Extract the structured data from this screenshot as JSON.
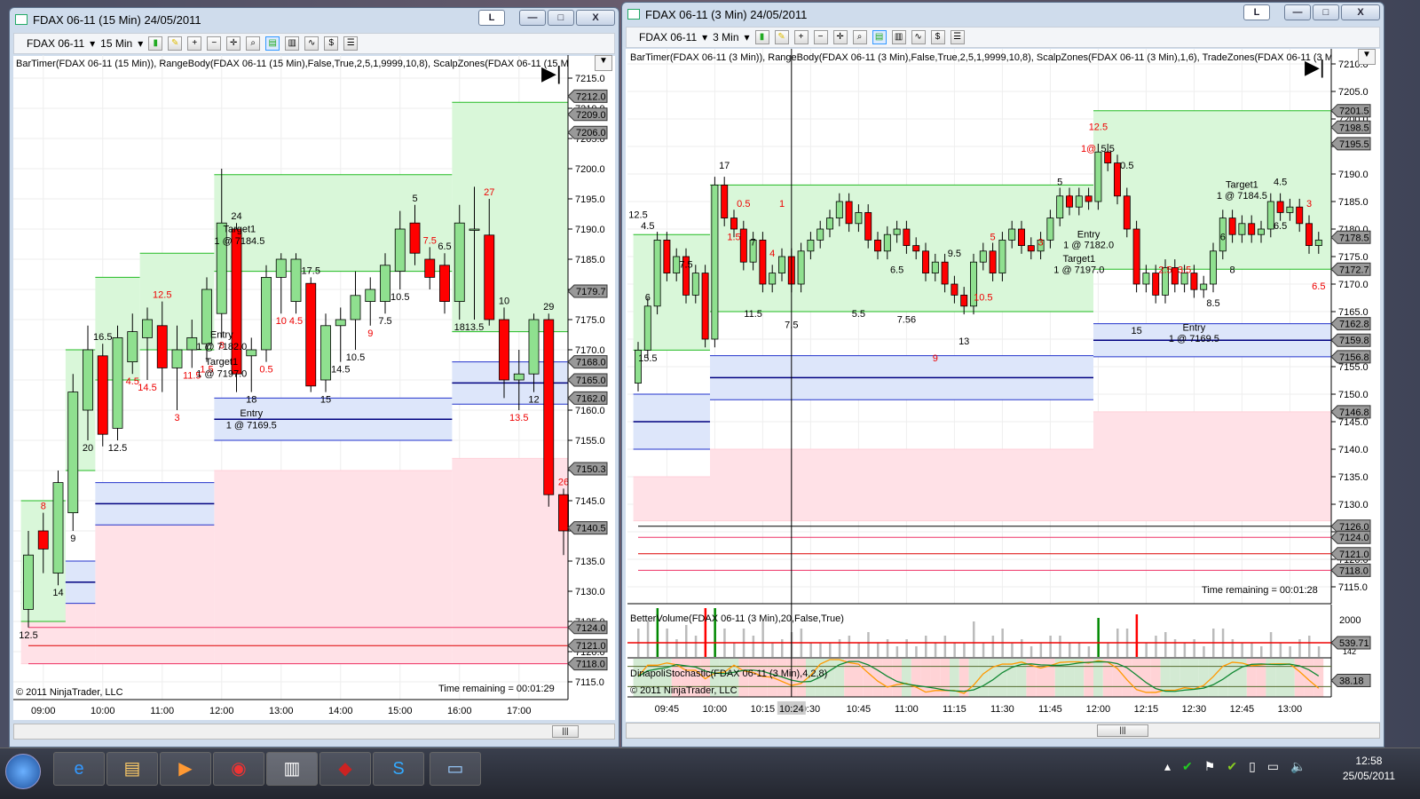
{
  "left": {
    "title": "FDAX 06-11 (15 Min)  24/05/2011",
    "instrument": "FDAX 06-11",
    "interval": "15 Min",
    "L": "L",
    "indicators": "BarTimer(FDAX 06-11 (15 Min)), RangeBody(FDAX 06-11 (15 Min),False,True,2,5,1,9999,10,8), ScalpZones(FDAX 06-11 (15 Min",
    "copyright": "© 2011 NinjaTrader, LLC",
    "time_remaining": "Time remaining = 00:01:29",
    "price_ticks": [
      7215,
      7210,
      7205,
      7200,
      7195,
      7190,
      7185,
      7180,
      7175,
      7170,
      7165,
      7160,
      7155,
      7150,
      7145,
      7140,
      7135,
      7130,
      7125,
      7120,
      7115
    ],
    "price_tags": [
      "7212.0",
      "7209.0",
      "7206.0",
      "7179.7",
      "7168.0",
      "7165.0",
      "7162.0",
      "7150.3",
      "7140.5",
      "7124.0",
      "7121.0",
      "7118.0"
    ],
    "time_labels": [
      [
        "09:00",
        540
      ],
      [
        "10:00",
        600
      ],
      [
        "11:00",
        660
      ],
      [
        "12:00",
        720
      ],
      [
        "13:00",
        780
      ],
      [
        "14:00",
        840
      ],
      [
        "15:00",
        900
      ],
      [
        "16:00",
        960
      ],
      [
        "17:00",
        1020
      ]
    ],
    "candles": [
      [
        7127,
        7136,
        7140,
        7124,
        "12.5",
        "#000"
      ],
      [
        7140,
        7137,
        7143,
        7133,
        "8",
        "#e00"
      ],
      [
        7133,
        7148,
        7150,
        7131,
        "14",
        "#000"
      ],
      [
        7143,
        7163,
        7166,
        7140,
        "9",
        "#000"
      ],
      [
        7160,
        7170,
        7174,
        7155,
        "20",
        "#000"
      ],
      [
        7169,
        7156,
        7171,
        7154,
        "16.5",
        "#000"
      ],
      [
        7157,
        7172,
        7174,
        7155,
        "12.5",
        "#000"
      ],
      [
        7168,
        7173,
        7176,
        7166,
        "4.5",
        "#e00"
      ],
      [
        7172,
        7175,
        7177,
        7165,
        "14.5",
        "#e00"
      ],
      [
        7174,
        7167,
        7178,
        7163,
        "12.5",
        "#e00"
      ],
      [
        7167,
        7170,
        7174,
        7160,
        "3",
        "#e00"
      ],
      [
        7170,
        7172,
        7175,
        7167,
        "11.5",
        "#e00"
      ],
      [
        7171,
        7180,
        7182,
        7168,
        "1.5",
        "#e00"
      ],
      [
        7176,
        7191,
        7200,
        7172,
        "8",
        "#e00"
      ],
      [
        7190,
        7166,
        7191,
        7163,
        "24",
        "#000"
      ],
      [
        7169,
        7170,
        7172,
        7163,
        "18",
        "#000"
      ],
      [
        7170,
        7182,
        7184,
        7168,
        "0.5",
        "#e00"
      ],
      [
        7182,
        7185,
        7186,
        7176,
        "10",
        "#e00"
      ],
      [
        7178,
        7185,
        7186,
        7176,
        "4.5",
        "#e00"
      ],
      [
        7181,
        7164,
        7182,
        7163,
        "17.5",
        "#000"
      ],
      [
        7165,
        7174,
        7176,
        7163,
        "15",
        "#000"
      ],
      [
        7174,
        7175,
        7177,
        7168,
        "14.5",
        "#000"
      ],
      [
        7175,
        7179,
        7183,
        7170,
        "10.5",
        "#000"
      ],
      [
        7178,
        7180,
        7182,
        7174,
        "9",
        "#e00"
      ],
      [
        7178,
        7184,
        7186,
        7176,
        "7.5",
        "#000"
      ],
      [
        7183,
        7190,
        7193,
        7180,
        "10.5",
        "#000"
      ],
      [
        7191,
        7186,
        7194,
        7184,
        "5",
        "#000"
      ],
      [
        7185,
        7182,
        7187,
        7180,
        "7.5",
        "#e00"
      ],
      [
        7184,
        7178,
        7186,
        7176,
        "6.5",
        "#000"
      ],
      [
        7178,
        7191,
        7194,
        7175,
        "18",
        "#000"
      ],
      [
        7190,
        7190,
        7197,
        7175,
        "13.5",
        "#000"
      ],
      [
        7189,
        7175,
        7195,
        7174,
        "27",
        "#e00"
      ],
      [
        7175,
        7165,
        7177,
        7162,
        "10",
        "#000"
      ],
      [
        7165,
        7166,
        7170,
        7160,
        "13.5",
        "#e00"
      ],
      [
        7166,
        7175,
        7176,
        7163,
        "12",
        "#000"
      ],
      [
        7175,
        7146,
        7176,
        7144,
        "29",
        "#000"
      ],
      [
        7146,
        7140,
        7147,
        7136,
        "26",
        "#e00"
      ]
    ],
    "zones": {
      "green": [
        [
          0,
          7145,
          7125
        ],
        [
          3,
          7170,
          7150
        ],
        [
          5,
          7182,
          7165
        ],
        [
          8,
          7186,
          7170
        ],
        [
          13,
          7199,
          7183
        ],
        [
          29,
          7211,
          7173
        ]
      ],
      "blue": [
        [
          0,
          7135,
          7128
        ],
        [
          5,
          7148,
          7141
        ],
        [
          13,
          7162,
          7155
        ],
        [
          29,
          7168,
          7161
        ]
      ],
      "pink": [
        [
          0,
          7128,
          7118
        ],
        [
          5,
          7141,
          7118
        ],
        [
          13,
          7150,
          7118
        ],
        [
          29,
          7152,
          7118
        ]
      ]
    },
    "lines": [
      [
        7124,
        "#ee3366"
      ],
      [
        7121,
        "#dd0000"
      ],
      [
        7118,
        "#ee3366"
      ]
    ],
    "orders": [
      [
        "Target1",
        14.2,
        7189.5
      ],
      [
        "1 @ 7184.5",
        14.2,
        7187.5
      ],
      [
        "Entry",
        13,
        7172
      ],
      [
        "1 @ 7182.0",
        13,
        7170
      ],
      [
        "Target1",
        13,
        7167.5
      ],
      [
        "1 @ 7197.0",
        13,
        7165.5
      ],
      [
        "Entry",
        15,
        7159
      ],
      [
        "1 @ 7169.5",
        15,
        7157
      ]
    ]
  },
  "right": {
    "title": "FDAX 06-11 (3 Min)  24/05/2011",
    "instrument": "FDAX 06-11",
    "interval": "3 Min",
    "L": "L",
    "indicators": "BarTimer(FDAX 06-11 (3 Min)), RangeBody(FDAX 06-11 (3 Min),False,True,2,5,1,9999,10,8), ScalpZones(FDAX 06-11 (3 Min),1,6), TradeZones(FDAX 06-11 (3 Min",
    "copyright": "© 2011 NinjaTrader, LLC",
    "time_remaining": "Time remaining = 00:01:28",
    "volume_label": "BetterVolume(FDAX 06-11 (3 Min),20,False,True)",
    "volume_ticks": [
      "2000",
      "539.71",
      "142"
    ],
    "stoch_label": "DinapoliStochastic(FDAX 06-11 (3 Min),4,2,8)",
    "stoch_tag": "38.18",
    "crosshair_time": "10:24",
    "price_ticks": [
      7210,
      7205,
      7200,
      7195,
      7190,
      7185,
      7180,
      7175,
      7170,
      7165,
      7160,
      7155,
      7150,
      7145,
      7140,
      7135,
      7130,
      7125,
      7120,
      7115
    ],
    "price_tags": [
      "7201.5",
      "7198.5",
      "7195.5",
      "7178.5",
      "7172.7",
      "7162.8",
      "7159.8",
      "7156.8",
      "7146.8",
      "7126.0",
      "7124.0",
      "7121.0",
      "7118.0"
    ],
    "time_labels": [
      [
        "09:45",
        585
      ],
      [
        "10:00",
        600
      ],
      [
        "10:15",
        615
      ],
      [
        "0:30",
        630
      ],
      [
        "10:45",
        645
      ],
      [
        "11:00",
        660
      ],
      [
        "11:15",
        675
      ],
      [
        "11:30",
        690
      ],
      [
        "11:45",
        705
      ],
      [
        "12:00",
        720
      ],
      [
        "12:15",
        735
      ],
      [
        "12:30",
        750
      ],
      [
        "12:45",
        765
      ],
      [
        "13:00",
        780
      ]
    ],
    "first_open": 7152,
    "closes": [
      7158,
      7166,
      7178,
      7172,
      7175,
      7168,
      7172,
      7160,
      7188,
      7182,
      7180,
      7174,
      7178,
      7170,
      7172,
      7175,
      7170,
      7176,
      7178,
      7180,
      7182,
      7185,
      7181,
      7183,
      7178,
      7176,
      7179,
      7180,
      7177,
      7176,
      7172,
      7174,
      7170,
      7168,
      7166,
      7174,
      7176,
      7172,
      7178,
      7180,
      7177,
      7176,
      7178,
      7182,
      7186,
      7184,
      7186,
      7185,
      7194,
      7192,
      7186,
      7180,
      7170,
      7172,
      7168,
      7173,
      7170,
      7172,
      7169,
      7170,
      7176,
      7182,
      7179,
      7181,
      7179,
      7180,
      7185,
      7183,
      7184,
      7181,
      7177,
      7178
    ],
    "zones": {
      "green": [
        [
          0,
          7179,
          7158
        ],
        [
          8,
          7188,
          7165
        ],
        [
          48,
          7201.5,
          7172.7
        ]
      ],
      "blue": [
        [
          0,
          7150,
          7140
        ],
        [
          8,
          7157,
          7149
        ],
        [
          48,
          7162.8,
          7156.8
        ]
      ],
      "pink": [
        [
          0,
          7135,
          7127
        ],
        [
          8,
          7140,
          7127
        ],
        [
          48,
          7146.8,
          7127
        ]
      ]
    },
    "lines": [
      [
        7126,
        "#000000"
      ],
      [
        7124,
        "#ee3366"
      ],
      [
        7121,
        "#dd0000"
      ],
      [
        7118,
        "#ee3366"
      ]
    ],
    "labels": [
      [
        "12.5",
        0,
        7182,
        "#000"
      ],
      [
        "4.5",
        1,
        7180,
        "#000"
      ],
      [
        "7.5",
        5,
        7173,
        "#000"
      ],
      [
        "6",
        1,
        7167,
        "#000"
      ],
      [
        "15.5",
        1,
        7156,
        "#000"
      ],
      [
        "17",
        9,
        7191,
        "#000"
      ],
      [
        "0.5",
        11,
        7184,
        "#e00"
      ],
      [
        "1.5",
        10,
        7178,
        "#e00"
      ],
      [
        "7",
        12,
        7177,
        "#000"
      ],
      [
        "11.5",
        12,
        7164,
        "#000"
      ],
      [
        "7.5",
        16,
        7162,
        "#000"
      ],
      [
        "1",
        15,
        7184,
        "#e00"
      ],
      [
        "4",
        14,
        7175,
        "#e00"
      ],
      [
        "5.5",
        23,
        7164,
        "#000"
      ],
      [
        "6.5",
        27,
        7172,
        "#000"
      ],
      [
        "9.5",
        33,
        7175,
        "#000"
      ],
      [
        "7.56",
        28,
        7163,
        "#000"
      ],
      [
        "13",
        34,
        7159,
        "#000"
      ],
      [
        "9",
        31,
        7156,
        "#e00"
      ],
      [
        "5",
        37,
        7178,
        "#e00"
      ],
      [
        "10.5",
        36,
        7167,
        "#e00"
      ],
      [
        "3",
        42,
        7177,
        "#e00"
      ],
      [
        "5",
        44,
        7188,
        "#000"
      ],
      [
        "0",
        45,
        7185,
        "#e00"
      ],
      [
        "1@",
        47,
        7194,
        "#e00"
      ],
      [
        "12.5",
        48,
        7198,
        "#e00"
      ],
      [
        "5.5",
        49,
        7194,
        "#000"
      ],
      [
        "0.5",
        51,
        7191,
        "#000"
      ],
      [
        "15",
        52,
        7161,
        "#000"
      ],
      [
        "2.5",
        55,
        7172,
        "#e00"
      ],
      [
        "3.5",
        57,
        7172,
        "#e00"
      ],
      [
        "8.5",
        60,
        7166,
        "#000"
      ],
      [
        "6",
        61,
        7178,
        "#000"
      ],
      [
        "8",
        62,
        7172,
        "#000"
      ],
      [
        "4.5",
        67,
        7188,
        "#000"
      ],
      [
        "6.5",
        67,
        7180,
        "#000"
      ],
      [
        "3",
        70,
        7184,
        "#e00"
      ],
      [
        "6.5",
        71,
        7169,
        "#e00"
      ]
    ],
    "orders": [
      [
        "Target1",
        63,
        7187.5
      ],
      [
        "1 @ 7184.5",
        63,
        7185.5
      ],
      [
        "Entry",
        47,
        7178.5
      ],
      [
        "1 @ 7182.0",
        47,
        7176.5
      ],
      [
        "Target1",
        46,
        7174
      ],
      [
        "1 @ 7197.0",
        46,
        7172
      ],
      [
        "Entry",
        58,
        7161.5
      ],
      [
        "1 @ 7169.5",
        58,
        7159.5
      ]
    ]
  },
  "taskbar": {
    "time": "12:58",
    "date": "25/05/2011"
  },
  "colors": {
    "up": "#8fe08f",
    "down": "#ff0000",
    "zone_green": "#d9f7d9",
    "zone_green_line": "#22bb22",
    "zone_blue": "#dde6fa",
    "zone_blue_line": "#2233cc",
    "zone_pink": "#ffe1e7"
  }
}
